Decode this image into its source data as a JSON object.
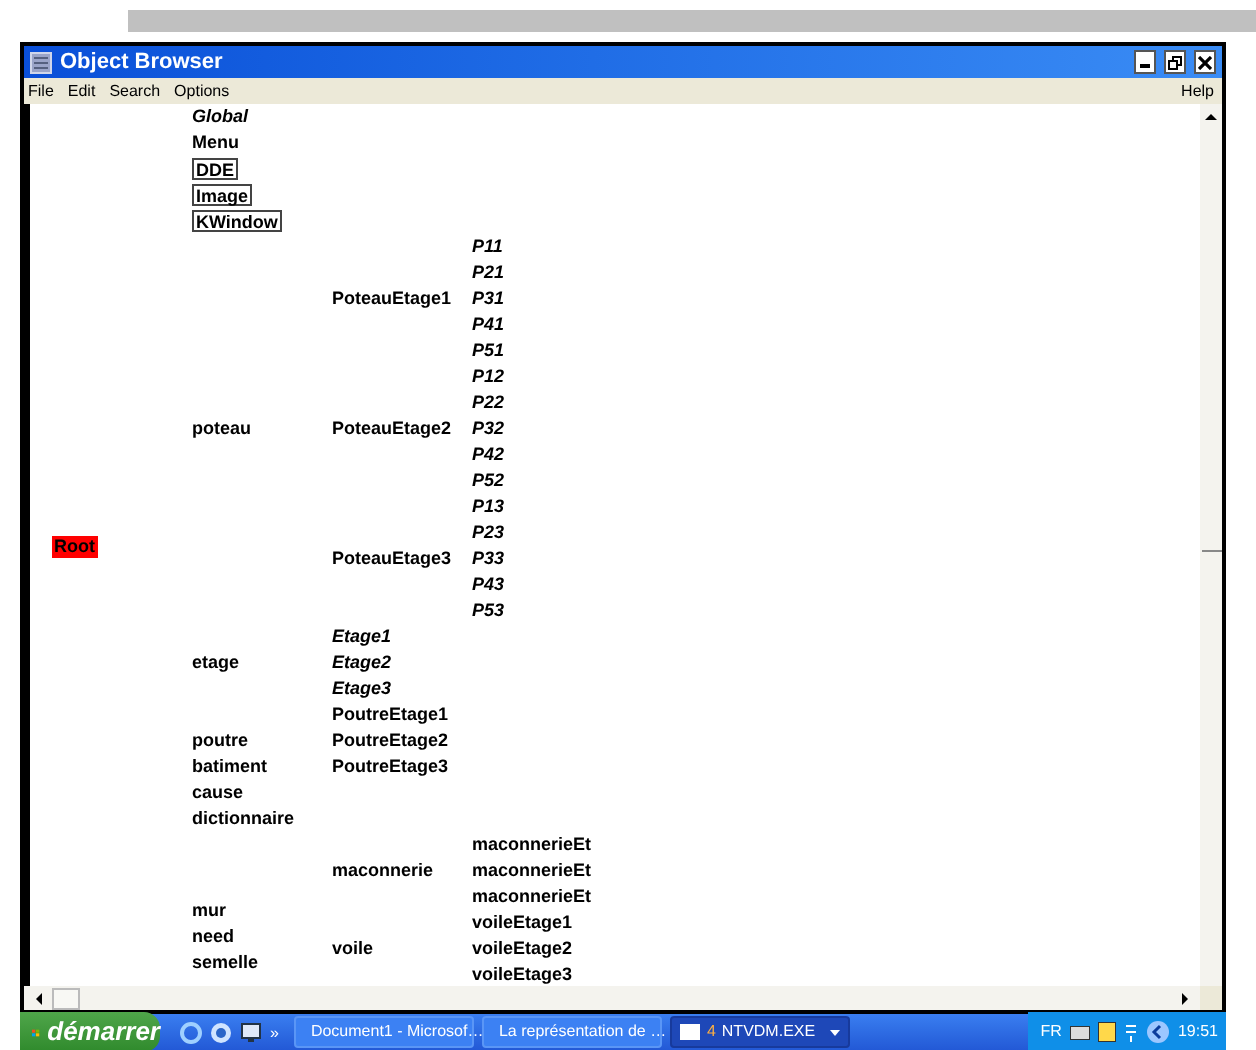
{
  "window": {
    "title": "Object Browser"
  },
  "menu": [
    {
      "label": "File"
    },
    {
      "label": "Edit"
    },
    {
      "label": "Search"
    },
    {
      "label": "Options"
    }
  ],
  "help_menu": {
    "label": "Help"
  },
  "tree": {
    "label": "Root",
    "kind": "root",
    "children": [
      {
        "label": "Global",
        "kind": "italic"
      },
      {
        "label": "Menu",
        "kind": "plain"
      },
      {
        "label": "DDE",
        "kind": "boxed"
      },
      {
        "label": "Image",
        "kind": "boxed"
      },
      {
        "label": "KWindow",
        "kind": "boxed"
      },
      {
        "label": "poteau",
        "kind": "plain",
        "children": [
          {
            "label": "PoteauEtage1",
            "kind": "plain",
            "children": [
              {
                "label": "P11",
                "kind": "italic"
              },
              {
                "label": "P21",
                "kind": "italic"
              },
              {
                "label": "P31",
                "kind": "italic"
              },
              {
                "label": "P41",
                "kind": "italic"
              },
              {
                "label": "P51",
                "kind": "italic"
              }
            ]
          },
          {
            "label": "PoteauEtage2",
            "kind": "plain",
            "children": [
              {
                "label": "P12",
                "kind": "italic"
              },
              {
                "label": "P22",
                "kind": "italic"
              },
              {
                "label": "P32",
                "kind": "italic"
              },
              {
                "label": "P42",
                "kind": "italic"
              },
              {
                "label": "P52",
                "kind": "italic"
              }
            ]
          },
          {
            "label": "PoteauEtage3",
            "kind": "plain",
            "children": [
              {
                "label": "P13",
                "kind": "italic"
              },
              {
                "label": "P23",
                "kind": "italic"
              },
              {
                "label": "P33",
                "kind": "italic"
              },
              {
                "label": "P43",
                "kind": "italic"
              },
              {
                "label": "P53",
                "kind": "italic"
              }
            ]
          }
        ]
      },
      {
        "label": "etage",
        "kind": "plain",
        "children": [
          {
            "label": "Etage1",
            "kind": "italic"
          },
          {
            "label": "Etage2",
            "kind": "italic"
          },
          {
            "label": "Etage3",
            "kind": "italic"
          }
        ]
      },
      {
        "label": "poutre",
        "kind": "plain",
        "children": [
          {
            "label": "PoutreEtage1",
            "kind": "plain"
          },
          {
            "label": "PoutreEtage2",
            "kind": "plain"
          },
          {
            "label": "PoutreEtage3",
            "kind": "plain"
          }
        ]
      },
      {
        "label": "batiment",
        "kind": "plain"
      },
      {
        "label": "cause",
        "kind": "plain"
      },
      {
        "label": "dictionnaire",
        "kind": "plain"
      },
      {
        "label": "mur",
        "kind": "plain",
        "children": [
          {
            "label": "maconnerie",
            "kind": "plain",
            "children": [
              {
                "label": "maconnerieEt",
                "kind": "plain"
              },
              {
                "label": "maconnerieEt",
                "kind": "plain"
              },
              {
                "label": "maconnerieEt",
                "kind": "plain"
              }
            ]
          },
          {
            "label": "voile",
            "kind": "plain",
            "children": [
              {
                "label": "voileEtage1",
                "kind": "plain"
              },
              {
                "label": "voileEtage2",
                "kind": "plain"
              },
              {
                "label": "voileEtage3",
                "kind": "plain"
              }
            ]
          }
        ]
      },
      {
        "label": "need",
        "kind": "plain"
      },
      {
        "label": "semelle",
        "kind": "plain"
      }
    ]
  },
  "taskbar": {
    "start": "démarrer",
    "quick_launch_more": "»",
    "tasks": [
      {
        "label": "Document1 - Microsof…",
        "selected": false
      },
      {
        "label": "La représentation de …",
        "selected": false
      },
      {
        "count": "4",
        "label": "NTVDM.EXE",
        "selected": true
      }
    ],
    "language": "FR",
    "clock": "19:51"
  }
}
